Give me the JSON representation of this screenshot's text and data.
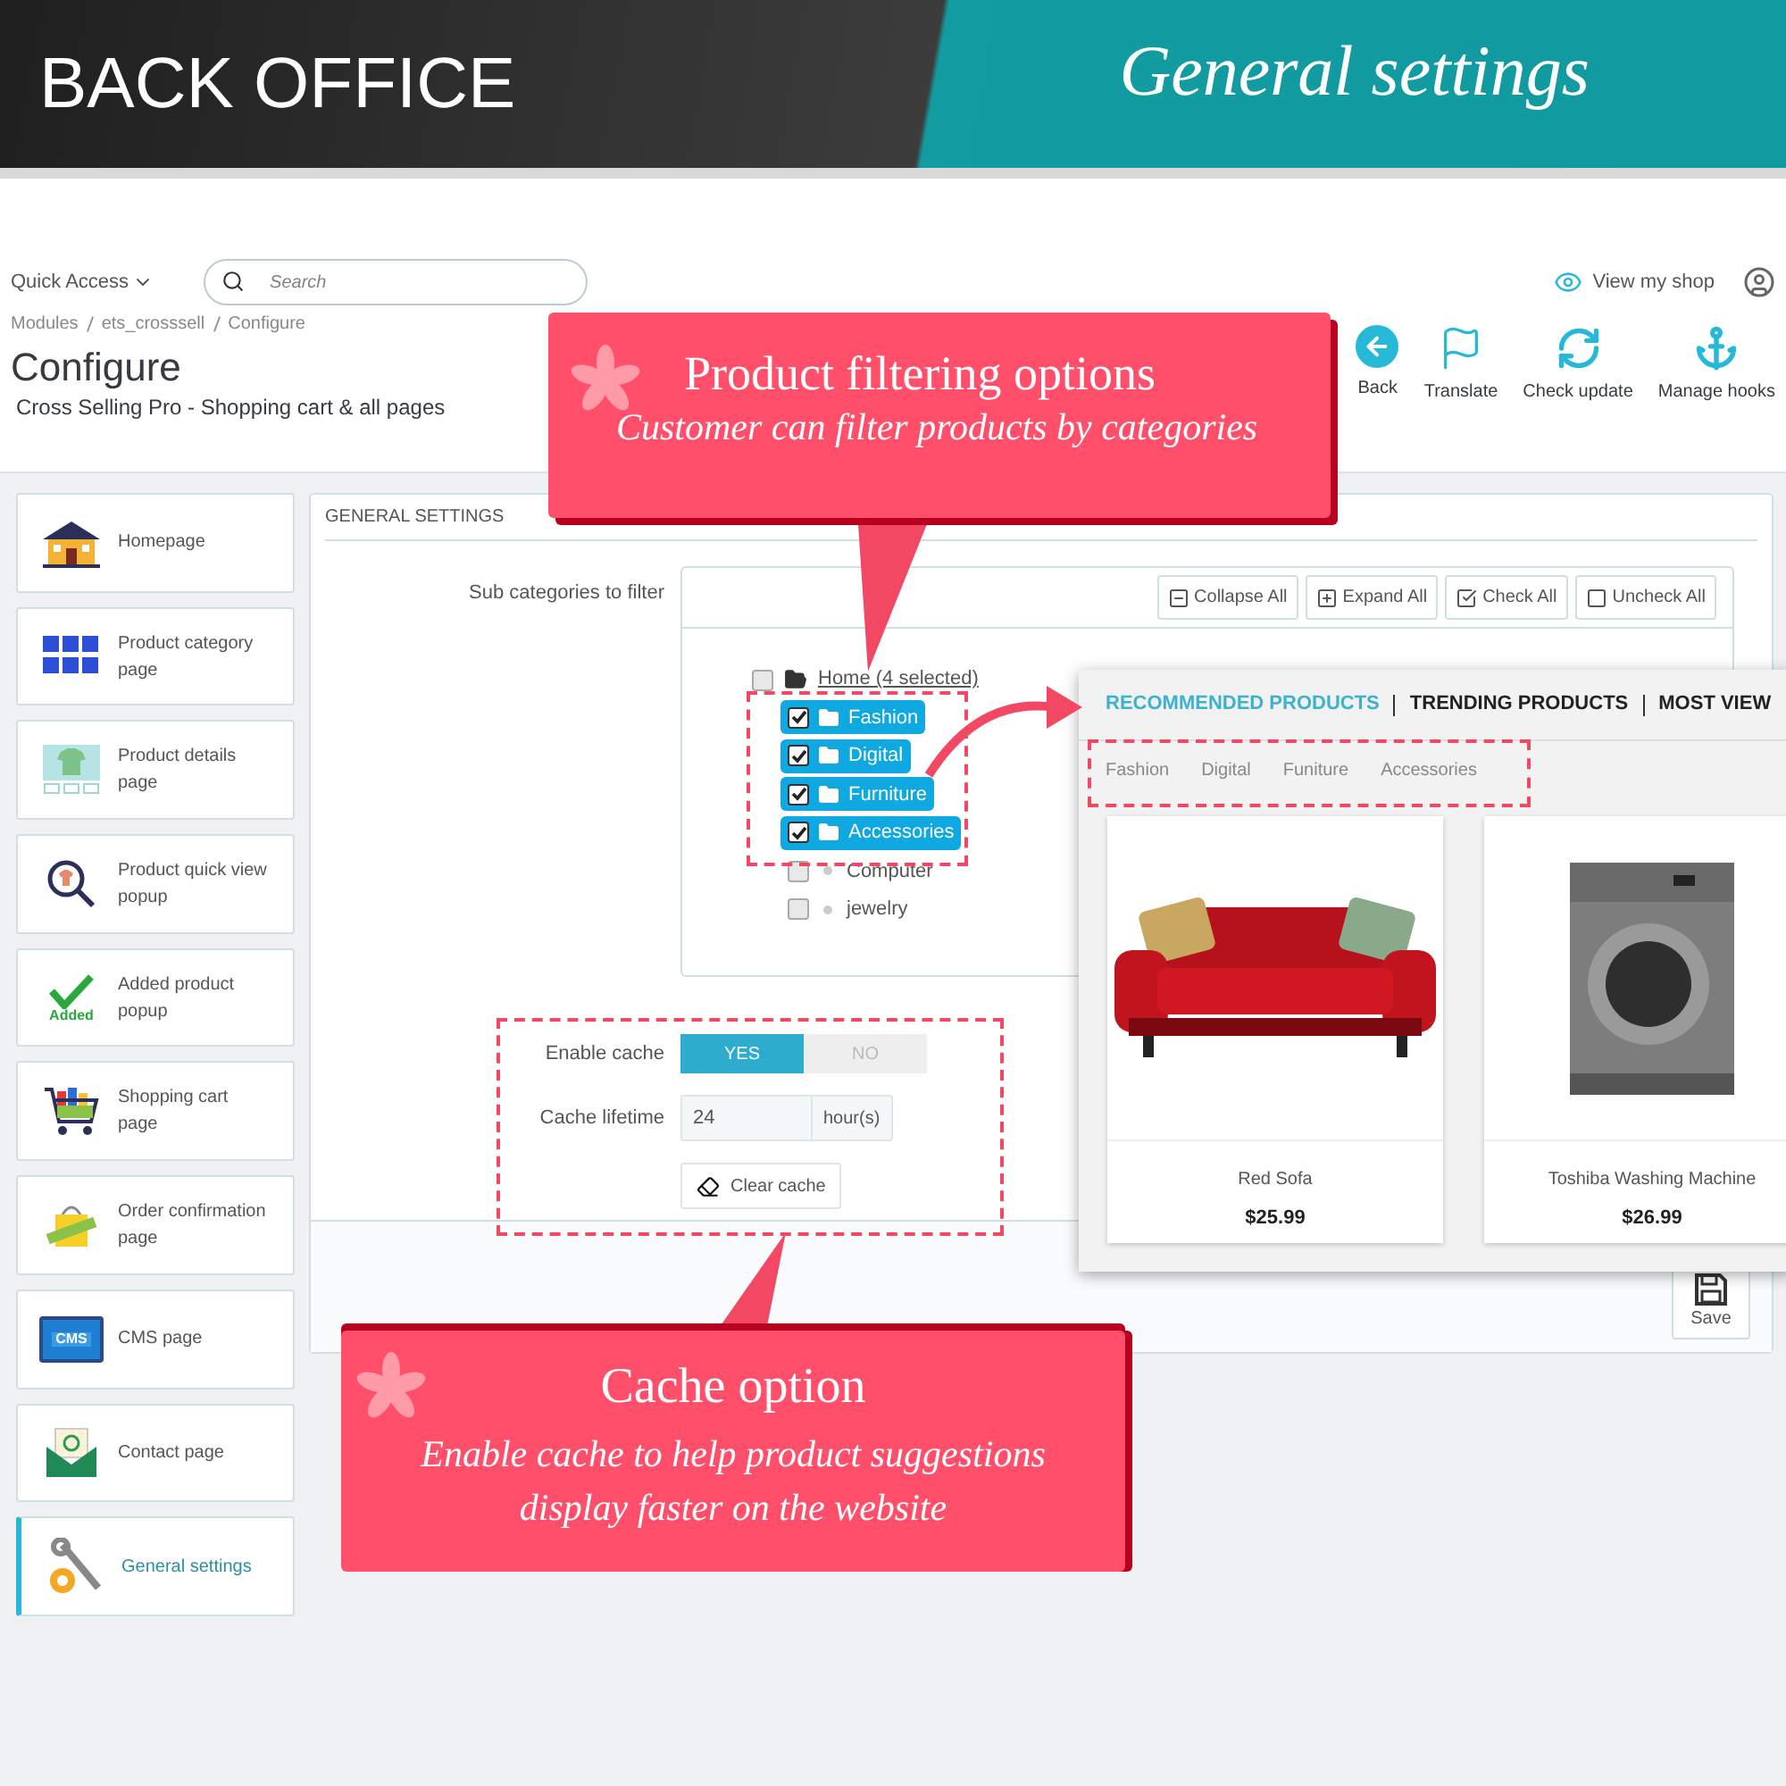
{
  "banner": {
    "left_title": "BACK OFFICE",
    "right_title": "General settings"
  },
  "header": {
    "quick_access": "Quick Access",
    "search": {
      "placeholder": "Search"
    },
    "view_shop": "View my shop"
  },
  "breadcrumb": [
    "Modules",
    "ets_crosssell",
    "Configure"
  ],
  "page_title": "Configure",
  "page_subtitle": "Cross Selling Pro - Shopping cart & all pages",
  "toolbar": [
    {
      "label": "Back",
      "kind": "back"
    },
    {
      "label": "Translate",
      "kind": "flag"
    },
    {
      "label": "Check update",
      "kind": "refresh"
    },
    {
      "label": "Manage hooks",
      "kind": "anchor"
    }
  ],
  "sidebar": {
    "items": [
      {
        "label": "Homepage",
        "kind": "home",
        "selected": false
      },
      {
        "label": "Product category page",
        "kind": "grid",
        "selected": false
      },
      {
        "label": "Product details page",
        "kind": "shirt",
        "selected": false
      },
      {
        "label": "Product quick view popup",
        "kind": "magnifier",
        "selected": false
      },
      {
        "label": "Added product popup",
        "kind": "check",
        "badge": "Added",
        "selected": false
      },
      {
        "label": "Shopping cart page",
        "kind": "cart",
        "selected": false
      },
      {
        "label": "Order confirmation page",
        "kind": "bag",
        "selected": false
      },
      {
        "label": "CMS page",
        "kind": "monitor",
        "badge": "CMS",
        "selected": false
      },
      {
        "label": "Contact page",
        "kind": "envelope",
        "selected": false
      },
      {
        "label": "General settings",
        "kind": "tools",
        "selected": true
      }
    ]
  },
  "panel": {
    "title": "GENERAL SETTINGS",
    "tree": {
      "label": "Sub categories to filter",
      "buttons": [
        {
          "label": "Collapse All",
          "kind": "minus"
        },
        {
          "label": "Expand All",
          "kind": "plus"
        },
        {
          "label": "Check All",
          "kind": "check"
        },
        {
          "label": "Uncheck All",
          "kind": "empty"
        }
      ],
      "items": [
        {
          "label": "Home (4 selected)",
          "checked": false,
          "children": [
            {
              "label": "Fashion",
              "checked": true
            },
            {
              "label": "Digital",
              "checked": true
            },
            {
              "label": "Furniture",
              "checked": true
            },
            {
              "label": "Accessories",
              "checked": true
            },
            {
              "label": "Computer",
              "checked": false
            },
            {
              "label": "jewelry",
              "checked": false
            }
          ]
        }
      ]
    },
    "enable_cache": {
      "label": "Enable cache",
      "options": [
        {
          "label": "YES",
          "selected": true
        },
        {
          "label": "NO",
          "selected": false
        }
      ]
    },
    "cache_lifetime": {
      "label": "Cache lifetime",
      "value": "24",
      "unit": "hour(s)"
    },
    "clear_cache": "Clear cache",
    "save": "Save"
  },
  "preview": {
    "tabs": [
      {
        "label": "RECOMMENDED PRODUCTS",
        "selected": true
      },
      {
        "label": "TRENDING PRODUCTS",
        "selected": false
      },
      {
        "label": "MOST VIEW",
        "selected": false
      }
    ],
    "filters": [
      "Fashion",
      "Digital",
      "Funiture",
      "Accessories"
    ],
    "products": [
      {
        "name": "Red Sofa",
        "price": "$25.99",
        "kind": "sofa"
      },
      {
        "name": "Toshiba Washing Machine",
        "price": "$26.99",
        "kind": "washer"
      }
    ]
  },
  "callouts": [
    {
      "title": "Product filtering options",
      "text": "Customer can filter products by categories"
    },
    {
      "title": "Cache option",
      "text": "Enable cache to help product suggestions display faster on the website"
    }
  ]
}
